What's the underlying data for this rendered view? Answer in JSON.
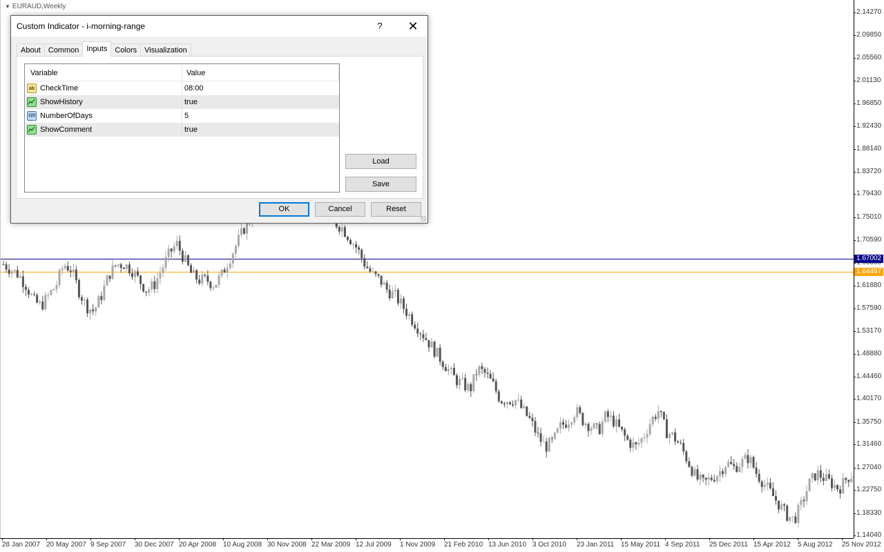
{
  "chart": {
    "symbol_label": "EURAUD,Weekly",
    "subtitle": "",
    "y_ticks": [
      "2.14270",
      "2.09850",
      "2.05560",
      "2.01130",
      "1.96850",
      "1.92430",
      "1.88140",
      "1.83720",
      "1.79430",
      "1.75010",
      "1.70590",
      "1.66300",
      "1.61880",
      "1.57590",
      "1.53170",
      "1.48880",
      "1.44460",
      "1.40170",
      "1.35750",
      "1.31460",
      "1.27040",
      "1.22750",
      "1.18330",
      "1.14040"
    ],
    "x_ticks": [
      "28 Jan 2007",
      "20 May 2007",
      "9 Sep 2007",
      "30 Dec 2007",
      "20 Apr 2008",
      "10 Aug 2008",
      "30 Nov 2008",
      "22 Mar 2009",
      "12 Jul 2009",
      "1 Nov 2009",
      "21 Feb 2010",
      "13 Jun 2010",
      "3 Oct 2010",
      "23 Jan 2011",
      "15 May 2011",
      "4 Sep 2011",
      "25 Dec 2011",
      "15 Apr 2012",
      "5 Aug 2012",
      "25 Nov 2012"
    ],
    "level_lines": [
      {
        "price": "1.67002",
        "color": "#00008b"
      },
      {
        "price": "1.64497",
        "color": "#ffa500"
      }
    ],
    "candle_color": "#888888",
    "background": "#ffffff"
  },
  "chart_data": {
    "type": "candlestick",
    "title": "EURAUD,Weekly",
    "ylim": [
      1.1404,
      2.1427
    ],
    "x_start": "28 Jan 2007",
    "x_end": "25 Nov 2012",
    "close_path": [
      1.66,
      1.65,
      1.64,
      1.62,
      1.59,
      1.58,
      1.6,
      1.62,
      1.66,
      1.65,
      1.61,
      1.58,
      1.57,
      1.6,
      1.64,
      1.66,
      1.66,
      1.65,
      1.63,
      1.61,
      1.62,
      1.65,
      1.68,
      1.7,
      1.67,
      1.64,
      1.63,
      1.63,
      1.62,
      1.64,
      1.67,
      1.7,
      1.73,
      1.75,
      1.77,
      1.8,
      1.82,
      1.83,
      1.82,
      1.8,
      1.79,
      1.78,
      1.76,
      1.75,
      1.74,
      1.73,
      1.71,
      1.69,
      1.66,
      1.64,
      1.63,
      1.61,
      1.6,
      1.58,
      1.56,
      1.54,
      1.52,
      1.5,
      1.48,
      1.46,
      1.44,
      1.43,
      1.42,
      1.46,
      1.45,
      1.43,
      1.4,
      1.4,
      1.4,
      1.38,
      1.36,
      1.33,
      1.31,
      1.32,
      1.35,
      1.36,
      1.38,
      1.36,
      1.35,
      1.34,
      1.37,
      1.36,
      1.34,
      1.32,
      1.31,
      1.33,
      1.36,
      1.38,
      1.34,
      1.33,
      1.31,
      1.28,
      1.25,
      1.24,
      1.25,
      1.26,
      1.28,
      1.27,
      1.28,
      1.29,
      1.26,
      1.24,
      1.22,
      1.2,
      1.18,
      1.17,
      1.2,
      1.24,
      1.26,
      1.25,
      1.24,
      1.23,
      1.25,
      1.26
    ]
  },
  "dialog": {
    "title": "Custom Indicator - i-morning-range",
    "help_label": "?",
    "close_label": "✕",
    "tabs": [
      {
        "label": "About",
        "active": false
      },
      {
        "label": "Common",
        "active": false
      },
      {
        "label": "Inputs",
        "active": true
      },
      {
        "label": "Colors",
        "active": false
      },
      {
        "label": "Visualization",
        "active": false
      }
    ],
    "table_headers": {
      "variable": "Variable",
      "value": "Value"
    },
    "params": [
      {
        "name": "CheckTime",
        "value": "08:00",
        "type": "text",
        "icon_text": "ab"
      },
      {
        "name": "ShowHistory",
        "value": "true",
        "type": "bool",
        "icon_text": ""
      },
      {
        "name": "NumberOfDays",
        "value": "5",
        "type": "num",
        "icon_text": "123"
      },
      {
        "name": "ShowComment",
        "value": "true",
        "type": "bool",
        "icon_text": ""
      }
    ],
    "load_label": "Load",
    "save_label": "Save",
    "ok_label": "OK",
    "cancel_label": "Cancel",
    "reset_label": "Reset",
    "accent_color": "#0078d7"
  }
}
